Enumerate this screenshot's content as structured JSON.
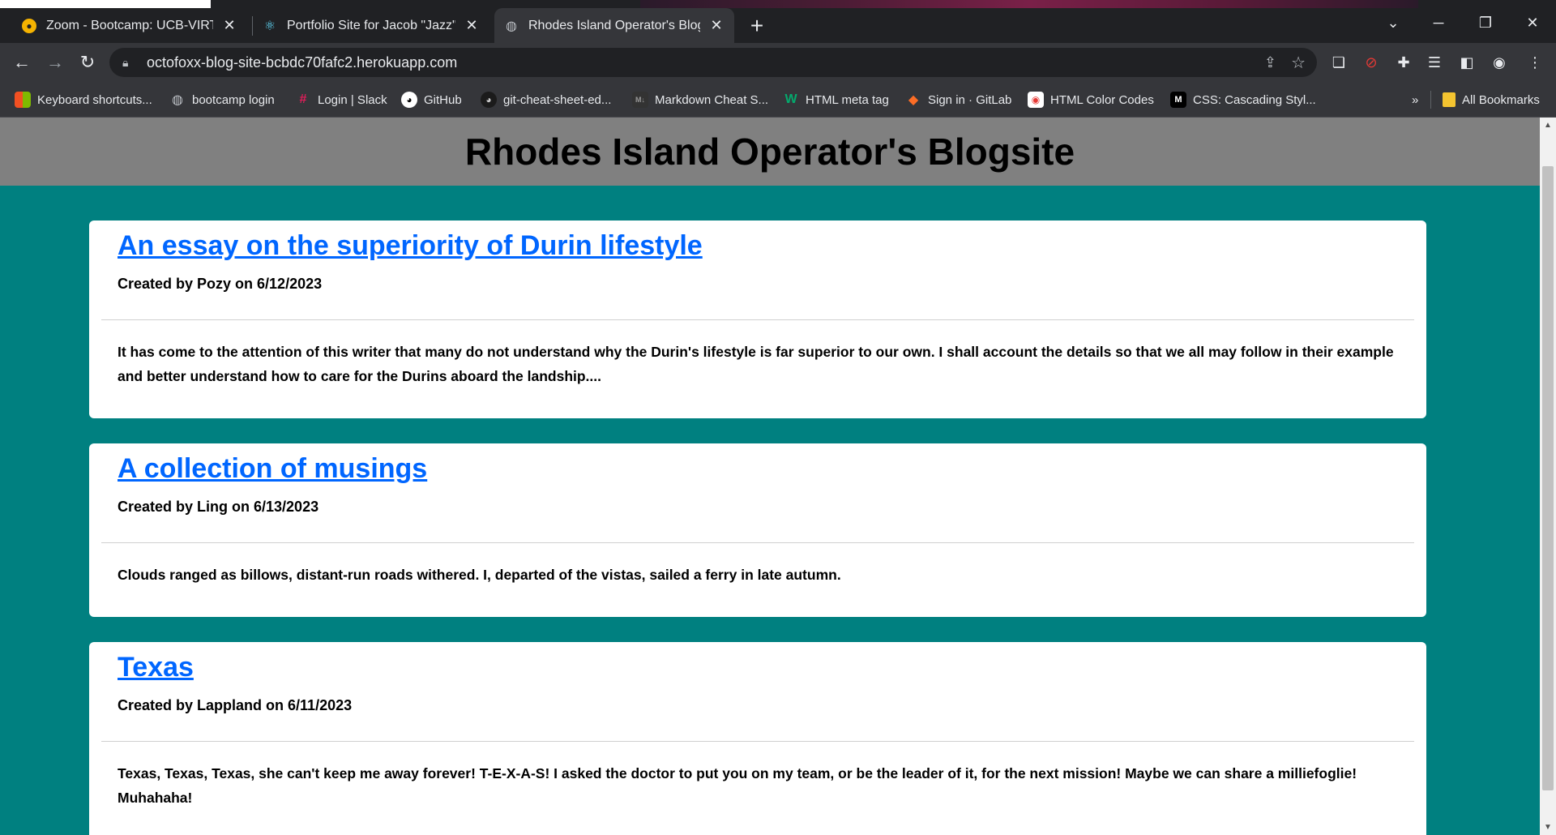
{
  "browser": {
    "tabs": [
      {
        "title": "Zoom - Bootcamp: UCB-VIRT-FS",
        "icon": "zoom-icon"
      },
      {
        "title": "Portfolio Site for Jacob \"Jazz\" Do",
        "icon": "react-icon"
      },
      {
        "title": "Rhodes Island Operator's Blogsit",
        "icon": "globe-icon",
        "active": true
      }
    ],
    "url": "octofoxx-blog-site-bcbdc70fafc2.herokuapp.com",
    "bookmarks": [
      {
        "label": "Keyboard shortcuts...",
        "icon": "microsoft-icon"
      },
      {
        "label": "bootcamp login",
        "icon": "globe-icon"
      },
      {
        "label": "Login | Slack",
        "icon": "slack-icon"
      },
      {
        "label": "GitHub",
        "icon": "github-icon"
      },
      {
        "label": "git-cheat-sheet-ed...",
        "icon": "github-icon"
      },
      {
        "label": "Markdown Cheat S...",
        "icon": "markdown-icon"
      },
      {
        "label": "HTML meta tag",
        "icon": "w-icon"
      },
      {
        "label": "Sign in · GitLab",
        "icon": "gitlab-icon"
      },
      {
        "label": "HTML Color Codes",
        "icon": "color-codes-icon"
      },
      {
        "label": "CSS: Cascading Styl...",
        "icon": "mdn-icon"
      }
    ],
    "overflow": "»",
    "all_bookmarks": "All Bookmarks"
  },
  "site": {
    "title": "Rhodes Island Operator's Blogsite"
  },
  "posts": [
    {
      "title": "An essay on the superiority of Durin lifestyle",
      "meta": "Created by Pozy on 6/12/2023",
      "body": "It has come to the attention of this writer that many do not understand why the Durin's lifestyle is far superior to our own. I shall account the details so that we all may follow in their example and better understand how to care for the Durins aboard the landship...."
    },
    {
      "title": "A collection of musings",
      "meta": "Created by Ling on 6/13/2023",
      "body": "Clouds ranged as billows, distant-run roads withered. I, departed of the vistas, sailed a ferry in late autumn."
    },
    {
      "title": "Texas",
      "meta": "Created by Lappland on 6/11/2023",
      "body": "Texas, Texas, Texas, she can't keep me away forever! T-E-X-A-S! I asked the doctor to put you on my team, or be the leader of it, for the next mission! Maybe we can share a milliefoglie! Muhahaha!"
    }
  ],
  "colors": {
    "page_bg": "#008080",
    "header_bg": "#808080",
    "link": "#0066ff"
  }
}
